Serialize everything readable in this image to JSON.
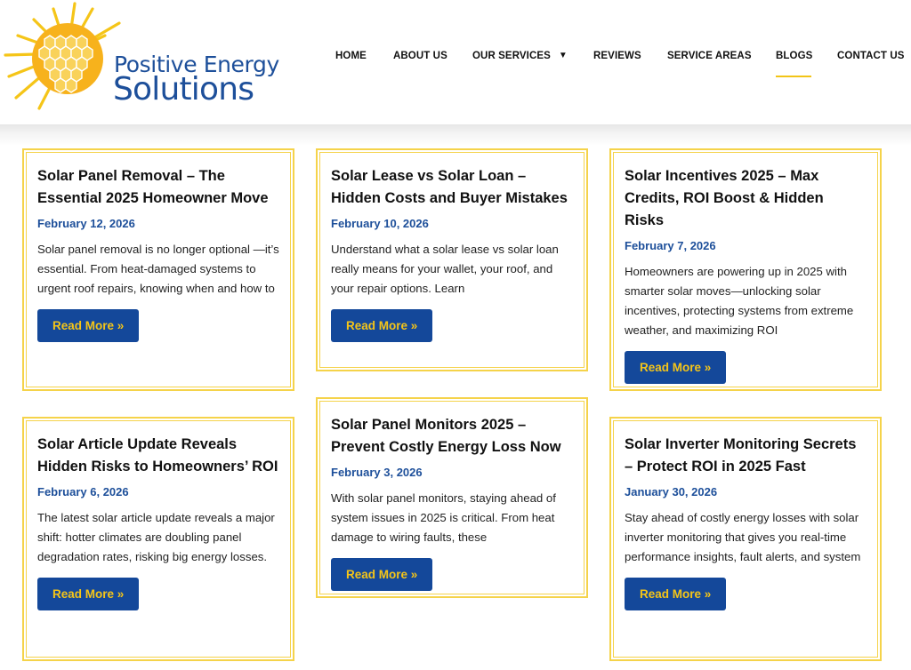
{
  "brand": {
    "line1": "Positive Energy",
    "line2": "Solutions",
    "primary_color": "#1d4f9a",
    "accent_color": "#f5c518"
  },
  "nav": {
    "items": [
      {
        "label": "HOME"
      },
      {
        "label": "ABOUT US"
      },
      {
        "label": "OUR SERVICES",
        "dropdown": true
      },
      {
        "label": "REVIEWS"
      },
      {
        "label": "SERVICE AREAS"
      },
      {
        "label": "BLOGS",
        "active": true
      },
      {
        "label": "CONTACT US"
      }
    ]
  },
  "posts": [
    {
      "title": "Solar Panel Removal – The Essential 2025 Homeowner Move",
      "date": "February 12, 2026",
      "excerpt": "Solar panel removal is no longer optional —it’s essential. From heat-damaged systems to urgent roof repairs, knowing when and how to",
      "button": "Read More »"
    },
    {
      "title": "Solar Lease vs Solar Loan – Hidden Costs and Buyer Mistakes",
      "date": "February 10, 2026",
      "excerpt": "Understand what a solar lease vs solar loan really means for your wallet, your roof, and your repair options. Learn",
      "button": "Read More »"
    },
    {
      "title": "Solar Incentives 2025 – Max Credits, ROI Boost & Hidden Risks",
      "date": "February 7, 2026",
      "excerpt": "Homeowners are powering up in 2025 with smarter solar moves—unlocking solar incentives, protecting systems from extreme weather, and maximizing ROI",
      "button": "Read More »"
    },
    {
      "title": "Solar Article Update Reveals Hidden Risks to Homeowners’ ROI",
      "date": "February 6, 2026",
      "excerpt": "The latest solar article update reveals a major shift: hotter climates are doubling panel degradation rates, risking big energy losses.",
      "button": "Read More »"
    },
    {
      "title": "Solar Panel Monitors 2025 – Prevent Costly Energy Loss Now",
      "date": "February 3, 2026",
      "excerpt": "With solar panel monitors, staying ahead of system issues in 2025 is critical. From heat damage to wiring faults, these",
      "button": "Read More »"
    },
    {
      "title": "Solar Inverter Monitoring Secrets – Protect ROI in 2025 Fast",
      "date": "January 30, 2026",
      "excerpt": "Stay ahead of costly energy losses with solar inverter monitoring that gives you real-time performance insights, fault alerts, and system",
      "button": "Read More »"
    }
  ]
}
